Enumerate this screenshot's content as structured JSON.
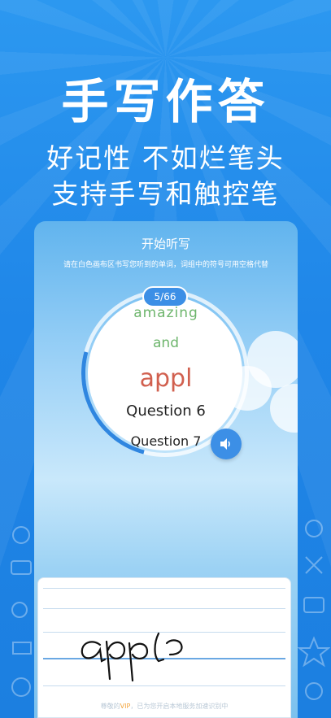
{
  "promo": {
    "headline": "手写作答",
    "subline1": "好记性 不如烂笔头",
    "subline2": "支持手写和触控笔"
  },
  "card": {
    "title": "开始听写",
    "hint": "请在白色画布区书写您听到的单词，词组中的符号可用空格代替",
    "counter": "5/66",
    "words": [
      "amazing",
      "and",
      "appl",
      "Question 6",
      "Question 7"
    ],
    "speaker_icon": "speaker-icon"
  },
  "pad": {
    "handwriting": "appl",
    "note_prefix": "尊敬的",
    "note_vip": "VIP",
    "note_suffix": "，已为您开启本地服务加速识别中"
  },
  "colors": {
    "background": "#2389eb",
    "accent": "#3c8fe6",
    "word_green": "#6db56c",
    "word_red": "#d1604f",
    "vip": "#f2a33a"
  }
}
